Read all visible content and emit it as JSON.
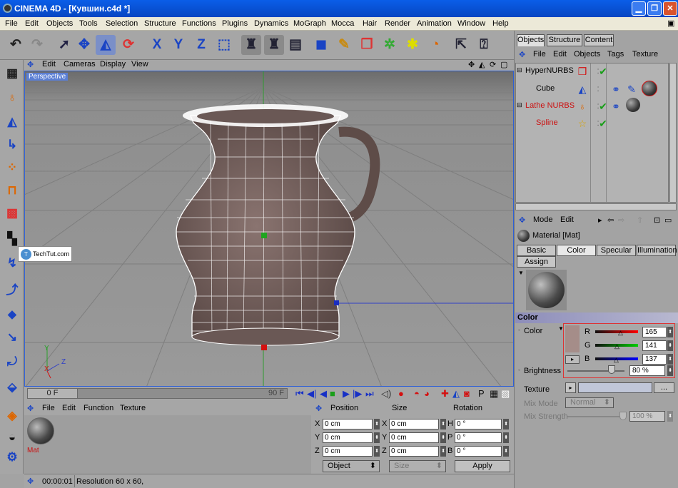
{
  "window": {
    "title": "CINEMA 4D - [Кувшин.c4d *]"
  },
  "menubar": [
    "File",
    "Edit",
    "Objects",
    "Tools",
    "Selection",
    "Structure",
    "Functions",
    "Plugins",
    "Dynamics",
    "MoGraph",
    "Mocca",
    "Hair",
    "Render",
    "Animation",
    "Window",
    "Help"
  ],
  "viewport": {
    "menu": [
      "Edit",
      "Cameras",
      "Display",
      "View"
    ],
    "label": "Perspective",
    "axis_y": "Y",
    "axis_z": "Z",
    "axis_x": "X"
  },
  "watermark": {
    "text": "TechTut.com"
  },
  "timeline": {
    "start": "0 F",
    "end": "90 F"
  },
  "material_manager": {
    "menu": [
      "File",
      "Edit",
      "Function",
      "Texture"
    ],
    "material_label": "Mat"
  },
  "coordinates": {
    "headers": [
      "Position",
      "Size",
      "Rotation"
    ],
    "rows": [
      {
        "p_axis": "X",
        "p_val": "0 cm",
        "s_axis": "X",
        "s_val": "0 cm",
        "r_axis": "H",
        "r_val": "0 °"
      },
      {
        "p_axis": "Y",
        "p_val": "0 cm",
        "s_axis": "Y",
        "s_val": "0 cm",
        "r_axis": "P",
        "r_val": "0 °"
      },
      {
        "p_axis": "Z",
        "p_val": "0 cm",
        "s_axis": "Z",
        "s_val": "0 cm",
        "r_axis": "B",
        "r_val": "0 °"
      }
    ],
    "mode_select": "Object",
    "size_select": "Size",
    "apply": "Apply"
  },
  "status": {
    "time": "00:00:01",
    "text": "Resolution 60 x 60,"
  },
  "object_manager": {
    "tabs": [
      "Objects",
      "Structure",
      "Content"
    ],
    "menu": [
      "File",
      "Edit",
      "Objects",
      "Tags",
      "Texture"
    ],
    "objects": [
      {
        "name": "HyperNURBS",
        "level": 0,
        "red": false
      },
      {
        "name": "Cube",
        "level": 1,
        "red": false
      },
      {
        "name": "Lathe NURBS",
        "level": 0,
        "red": true
      },
      {
        "name": "Spline",
        "level": 1,
        "red": true
      }
    ]
  },
  "attributes": {
    "menu": [
      "Mode",
      "Edit"
    ],
    "title": "Material [Mat]",
    "tabs": [
      "Basic",
      "Color",
      "Specular",
      "Illumination",
      "Assign"
    ],
    "active_tab": "Color",
    "section": "Color",
    "color_label": "Color",
    "r_label": "R",
    "r_value": "165",
    "g_label": "G",
    "g_value": "141",
    "b_label": "B",
    "b_value": "137",
    "brightness_label": "Brightness",
    "brightness_value": "80 %",
    "texture_label": "Texture",
    "texture_button": "...",
    "mix_mode_label": "Mix Mode",
    "mix_mode_value": "Normal",
    "mix_strength_label": "Mix Strength",
    "mix_strength_value": "100 %",
    "colors": {
      "swatch": "#a58d89"
    }
  }
}
